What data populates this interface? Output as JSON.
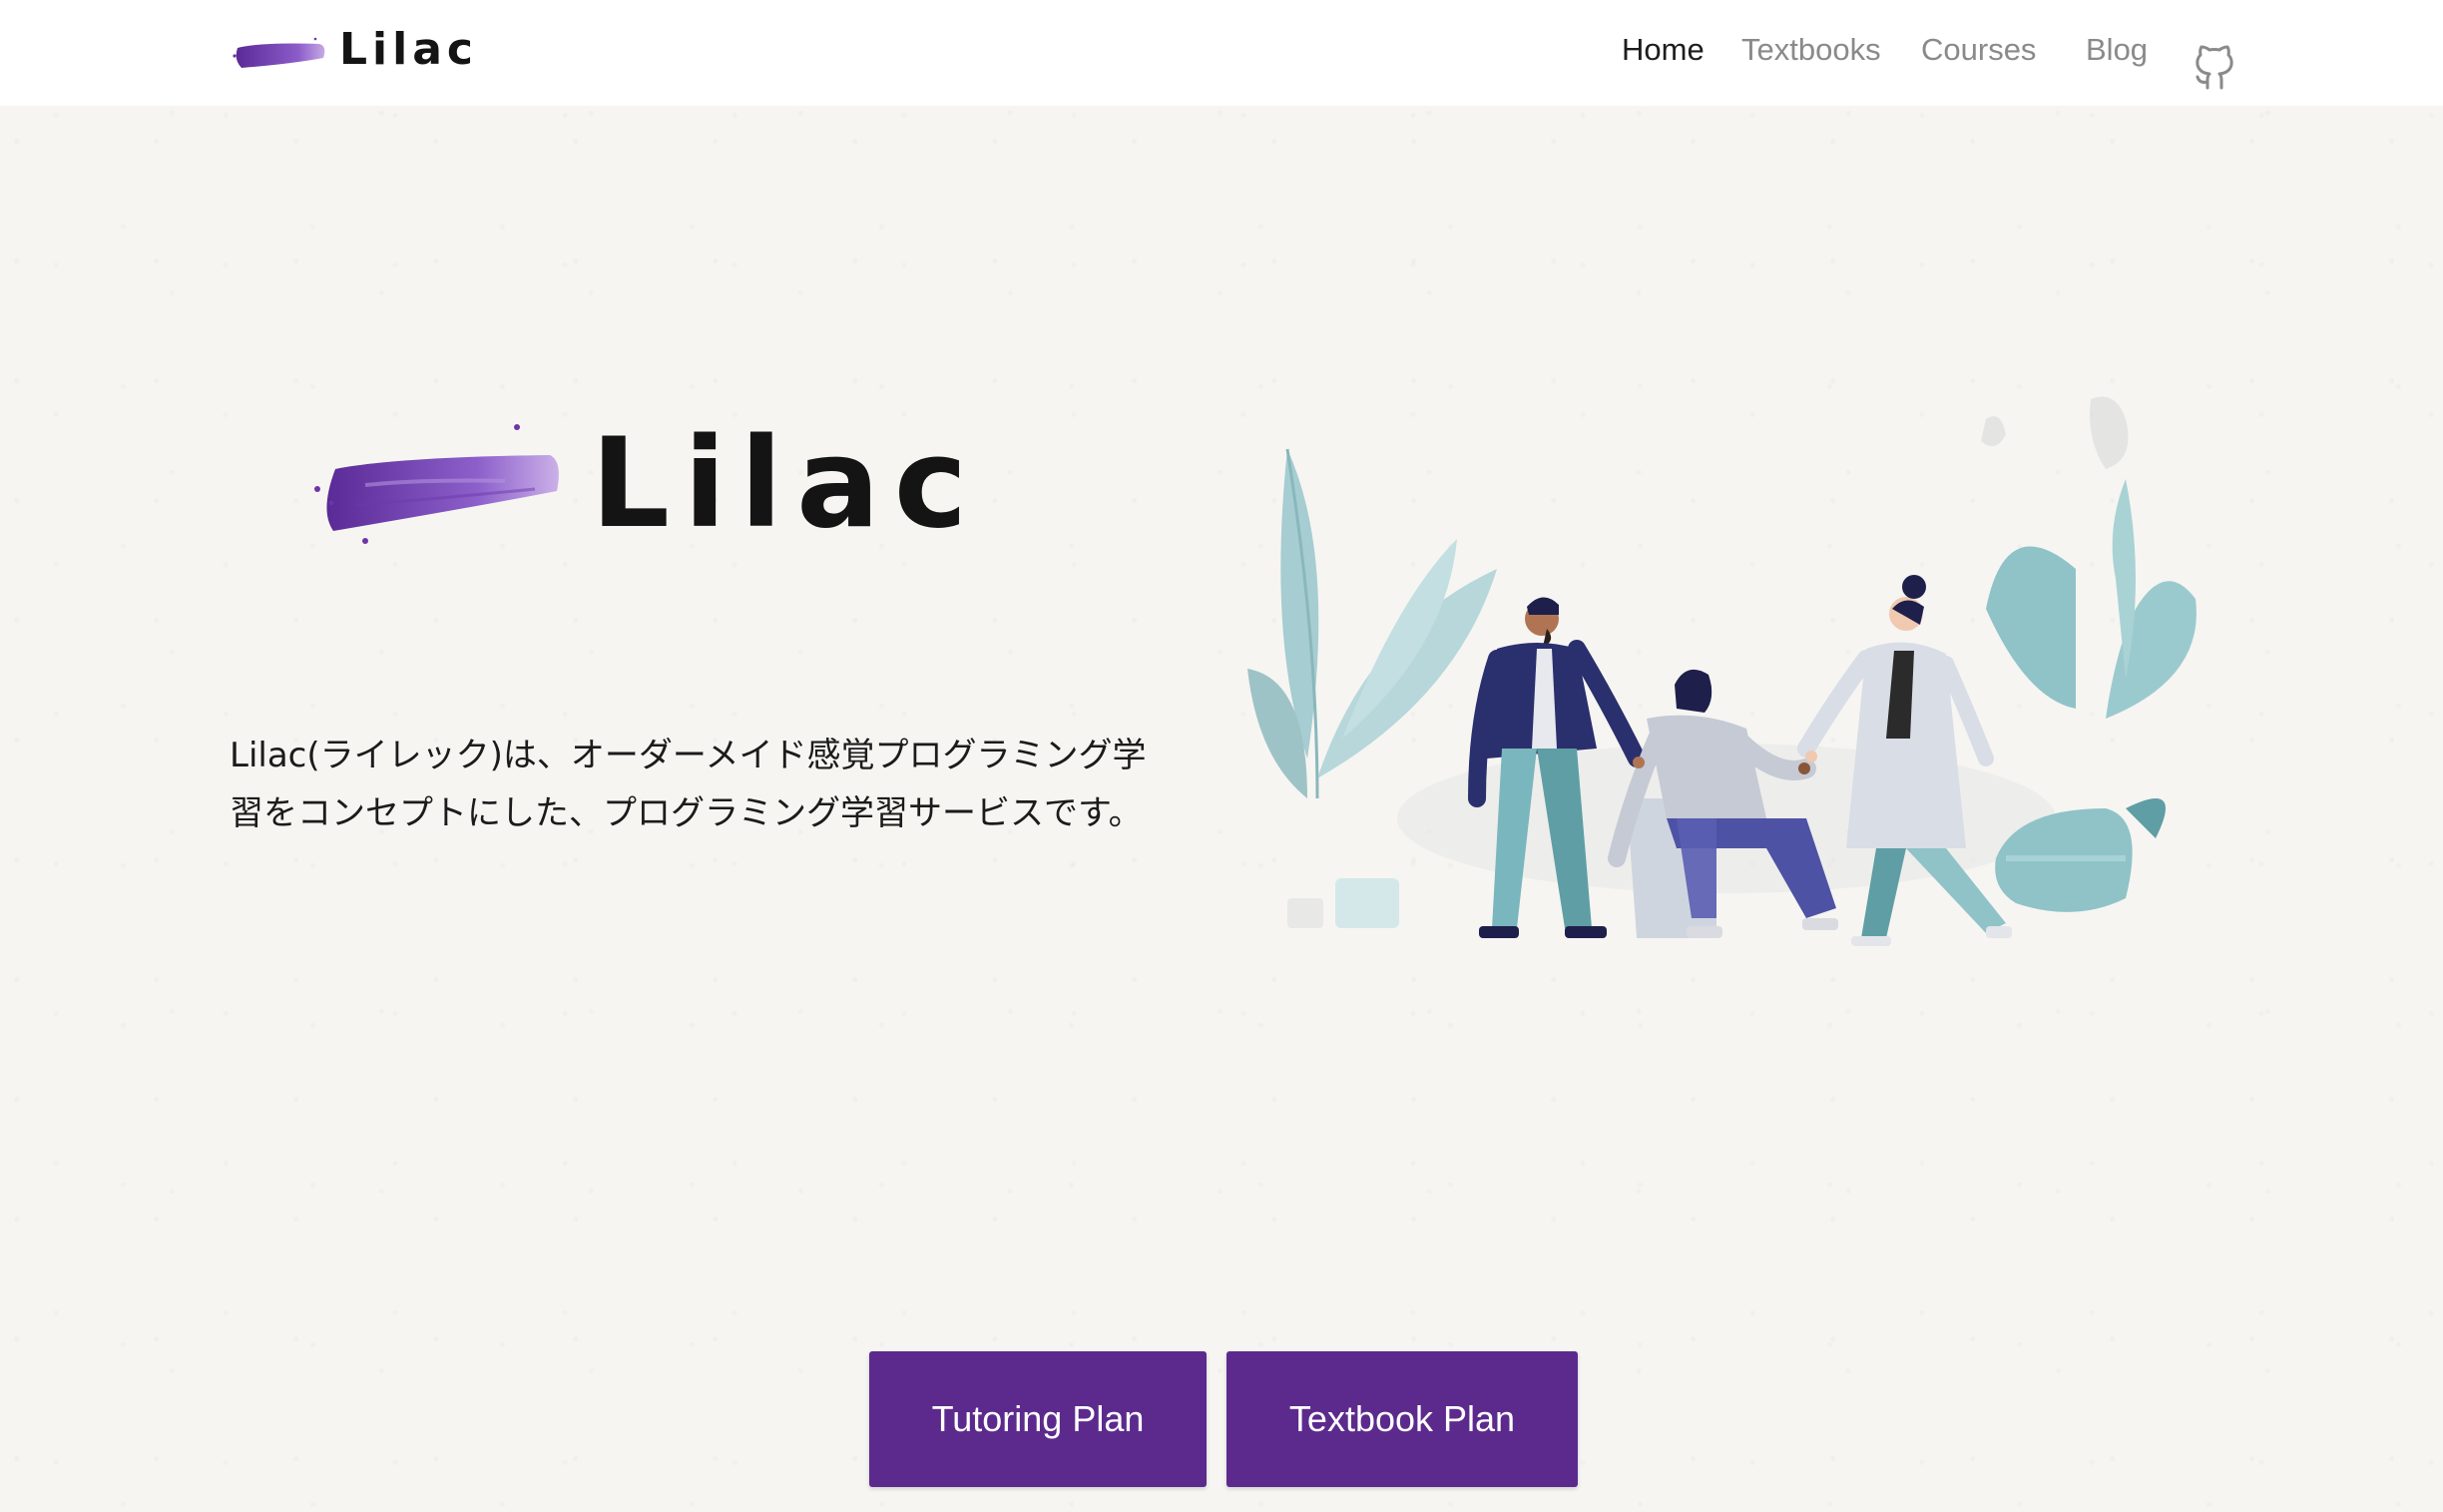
{
  "header": {
    "brand_name": "Lilac",
    "nav": {
      "home": "Home",
      "textbooks": "Textbooks",
      "courses": "Courses",
      "blog": "Blog"
    },
    "github_icon": "github-icon"
  },
  "hero": {
    "logo_text": "Lilac",
    "description_line1": "Lilac(ライレック)は、オーダーメイド感覚プログラミング学",
    "description_line2": "習をコンセプトにした、プログラミング学習サービスです。"
  },
  "buttons": {
    "tutoring": "Tutoring Plan",
    "textbook": "Textbook Plan"
  },
  "colors": {
    "accent": "#5c2a8d",
    "logo_purple": "#7a45b8",
    "background": "#f6f5f2",
    "plant_teal": "#8fc3c8"
  }
}
